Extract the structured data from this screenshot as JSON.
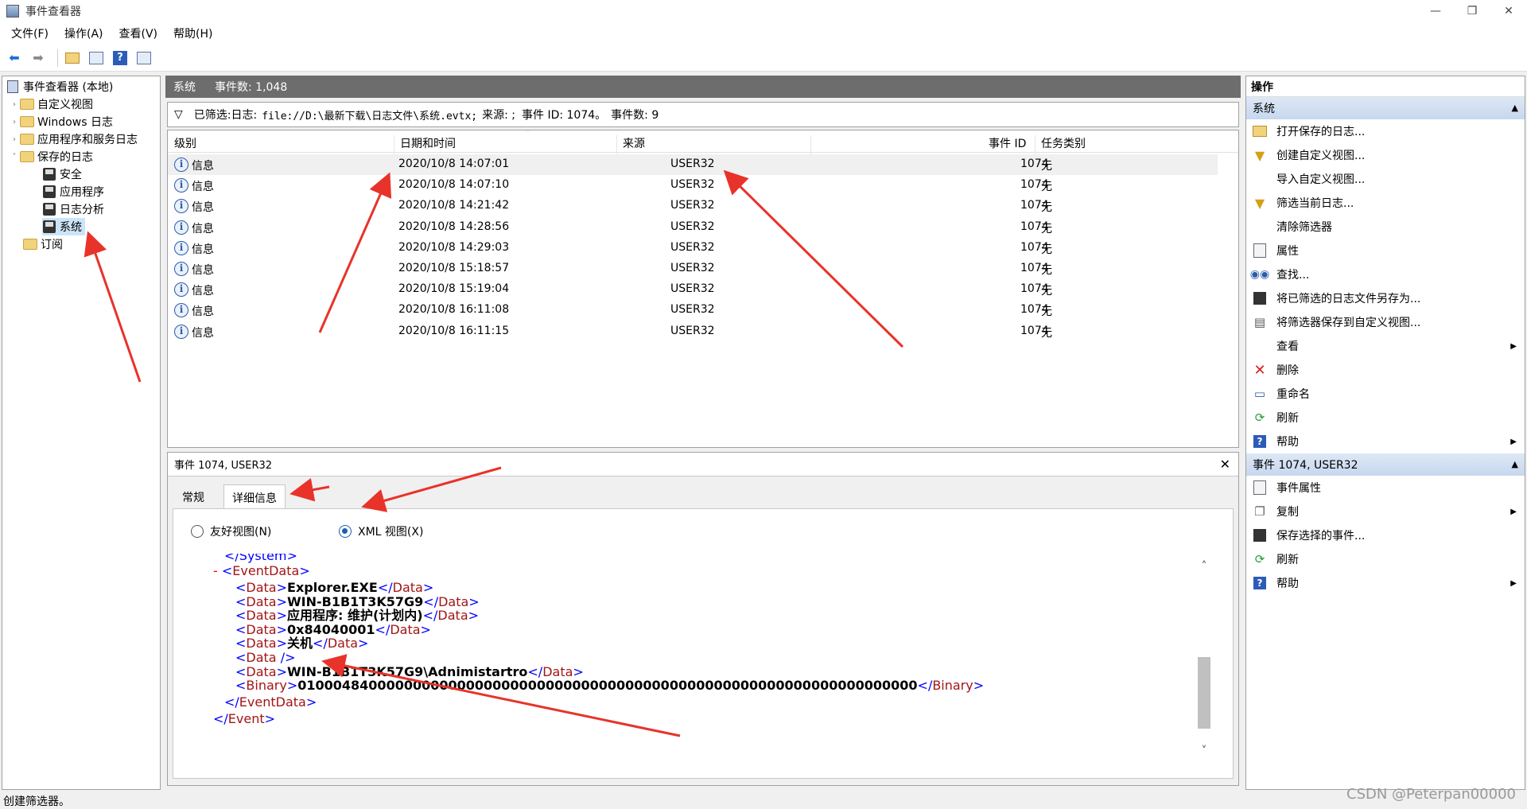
{
  "window": {
    "title": "事件查看器",
    "controls": [
      "—",
      "❐",
      "✕"
    ]
  },
  "menu": [
    "文件(F)",
    "操作(A)",
    "查看(V)",
    "帮助(H)"
  ],
  "toolbar": {
    "icons": [
      "back-arrow-icon",
      "forward-arrow-icon",
      "open-folder-icon",
      "console-tree-icon",
      "help-icon",
      "action-pane-icon"
    ]
  },
  "tree": {
    "root": "事件查看器 (本地)",
    "custom_views": "自定义视图",
    "windows_logs": "Windows 日志",
    "app_service_logs": "应用程序和服务日志",
    "saved_logs": "保存的日志",
    "saved_children": [
      "安全",
      "应用程序",
      "日志分析",
      "系统"
    ],
    "subscriptions": "订阅"
  },
  "middle": {
    "log_name": "系统",
    "event_count": "事件数: 1,048",
    "filter_prefix": "已筛选:日志:",
    "filter_path": "file://D:\\最新下载\\日志文件\\系统.evtx;",
    "filter_source": "来源: ;",
    "filter_id": "事件 ID: 1074。",
    "filter_count": "事件数: 9",
    "columns": [
      "级别",
      "日期和时间",
      "来源",
      "事件 ID",
      "任务类别"
    ],
    "rows": [
      {
        "level": "信息",
        "datetime": "2020/10/8 14:07:01",
        "source": "USER32",
        "id": "1074",
        "task": "无"
      },
      {
        "level": "信息",
        "datetime": "2020/10/8 14:07:10",
        "source": "USER32",
        "id": "1074",
        "task": "无"
      },
      {
        "level": "信息",
        "datetime": "2020/10/8 14:21:42",
        "source": "USER32",
        "id": "1074",
        "task": "无"
      },
      {
        "level": "信息",
        "datetime": "2020/10/8 14:28:56",
        "source": "USER32",
        "id": "1074",
        "task": "无"
      },
      {
        "level": "信息",
        "datetime": "2020/10/8 14:29:03",
        "source": "USER32",
        "id": "1074",
        "task": "无"
      },
      {
        "level": "信息",
        "datetime": "2020/10/8 15:18:57",
        "source": "USER32",
        "id": "1074",
        "task": "无"
      },
      {
        "level": "信息",
        "datetime": "2020/10/8 15:19:04",
        "source": "USER32",
        "id": "1074",
        "task": "无"
      },
      {
        "level": "信息",
        "datetime": "2020/10/8 16:11:08",
        "source": "USER32",
        "id": "1074",
        "task": "无"
      },
      {
        "level": "信息",
        "datetime": "2020/10/8 16:11:15",
        "source": "USER32",
        "id": "1074",
        "task": "无"
      }
    ]
  },
  "detail": {
    "header": "事件 1074, USER32",
    "tabs": [
      "常规",
      "详细信息"
    ],
    "radio_friendly": "友好视图(N)",
    "radio_xml": "XML 视图(X)",
    "xml": {
      "system_close": "</System>",
      "event_data_open": "EventData",
      "data_values": [
        "Explorer.EXE",
        "WIN-B1B1T3K57G9",
        "应用程序: 维护(计划内)",
        "0x84040001",
        "关机",
        "",
        "WIN-B1B1T3K57G9\\Adnimistartro"
      ],
      "binary_value": "0100048400000000000000000000000000000000000000000000000000000000000000",
      "event_data_close": "EventData",
      "event_close": "Event"
    }
  },
  "actions": {
    "title": "操作",
    "section1": "系统",
    "items1": [
      {
        "label": "打开保存的日志...",
        "icon": "open-folder-icon"
      },
      {
        "label": "创建自定义视图...",
        "icon": "filter-icon"
      },
      {
        "label": "导入自定义视图...",
        "icon": ""
      },
      {
        "label": "筛选当前日志...",
        "icon": "filter-icon"
      },
      {
        "label": "清除筛选器",
        "icon": ""
      },
      {
        "label": "属性",
        "icon": "properties-icon"
      },
      {
        "label": "查找...",
        "icon": "binoculars-icon"
      },
      {
        "label": "将已筛选的日志文件另存为...",
        "icon": "save-icon"
      },
      {
        "label": "将筛选器保存到自定义视图...",
        "icon": "save-filter-icon"
      },
      {
        "label": "查看",
        "icon": "",
        "submenu": true
      },
      {
        "label": "删除",
        "icon": "delete-icon"
      },
      {
        "label": "重命名",
        "icon": "rename-icon"
      },
      {
        "label": "刷新",
        "icon": "refresh-icon"
      },
      {
        "label": "帮助",
        "icon": "help-icon",
        "submenu": true
      }
    ],
    "section2": "事件 1074, USER32",
    "items2": [
      {
        "label": "事件属性",
        "icon": "properties-icon"
      },
      {
        "label": "复制",
        "icon": "copy-icon",
        "submenu": true
      },
      {
        "label": "保存选择的事件...",
        "icon": "save-icon"
      },
      {
        "label": "刷新",
        "icon": "refresh-icon"
      },
      {
        "label": "帮助",
        "icon": "help-icon",
        "submenu": true
      }
    ]
  },
  "status": "创建筛选器。",
  "watermark": "CSDN @Peterpan00000",
  "colors": {
    "annotation_red": "#e8332a",
    "header_gray": "#6d6d6d",
    "selection": "#cce4f7"
  }
}
